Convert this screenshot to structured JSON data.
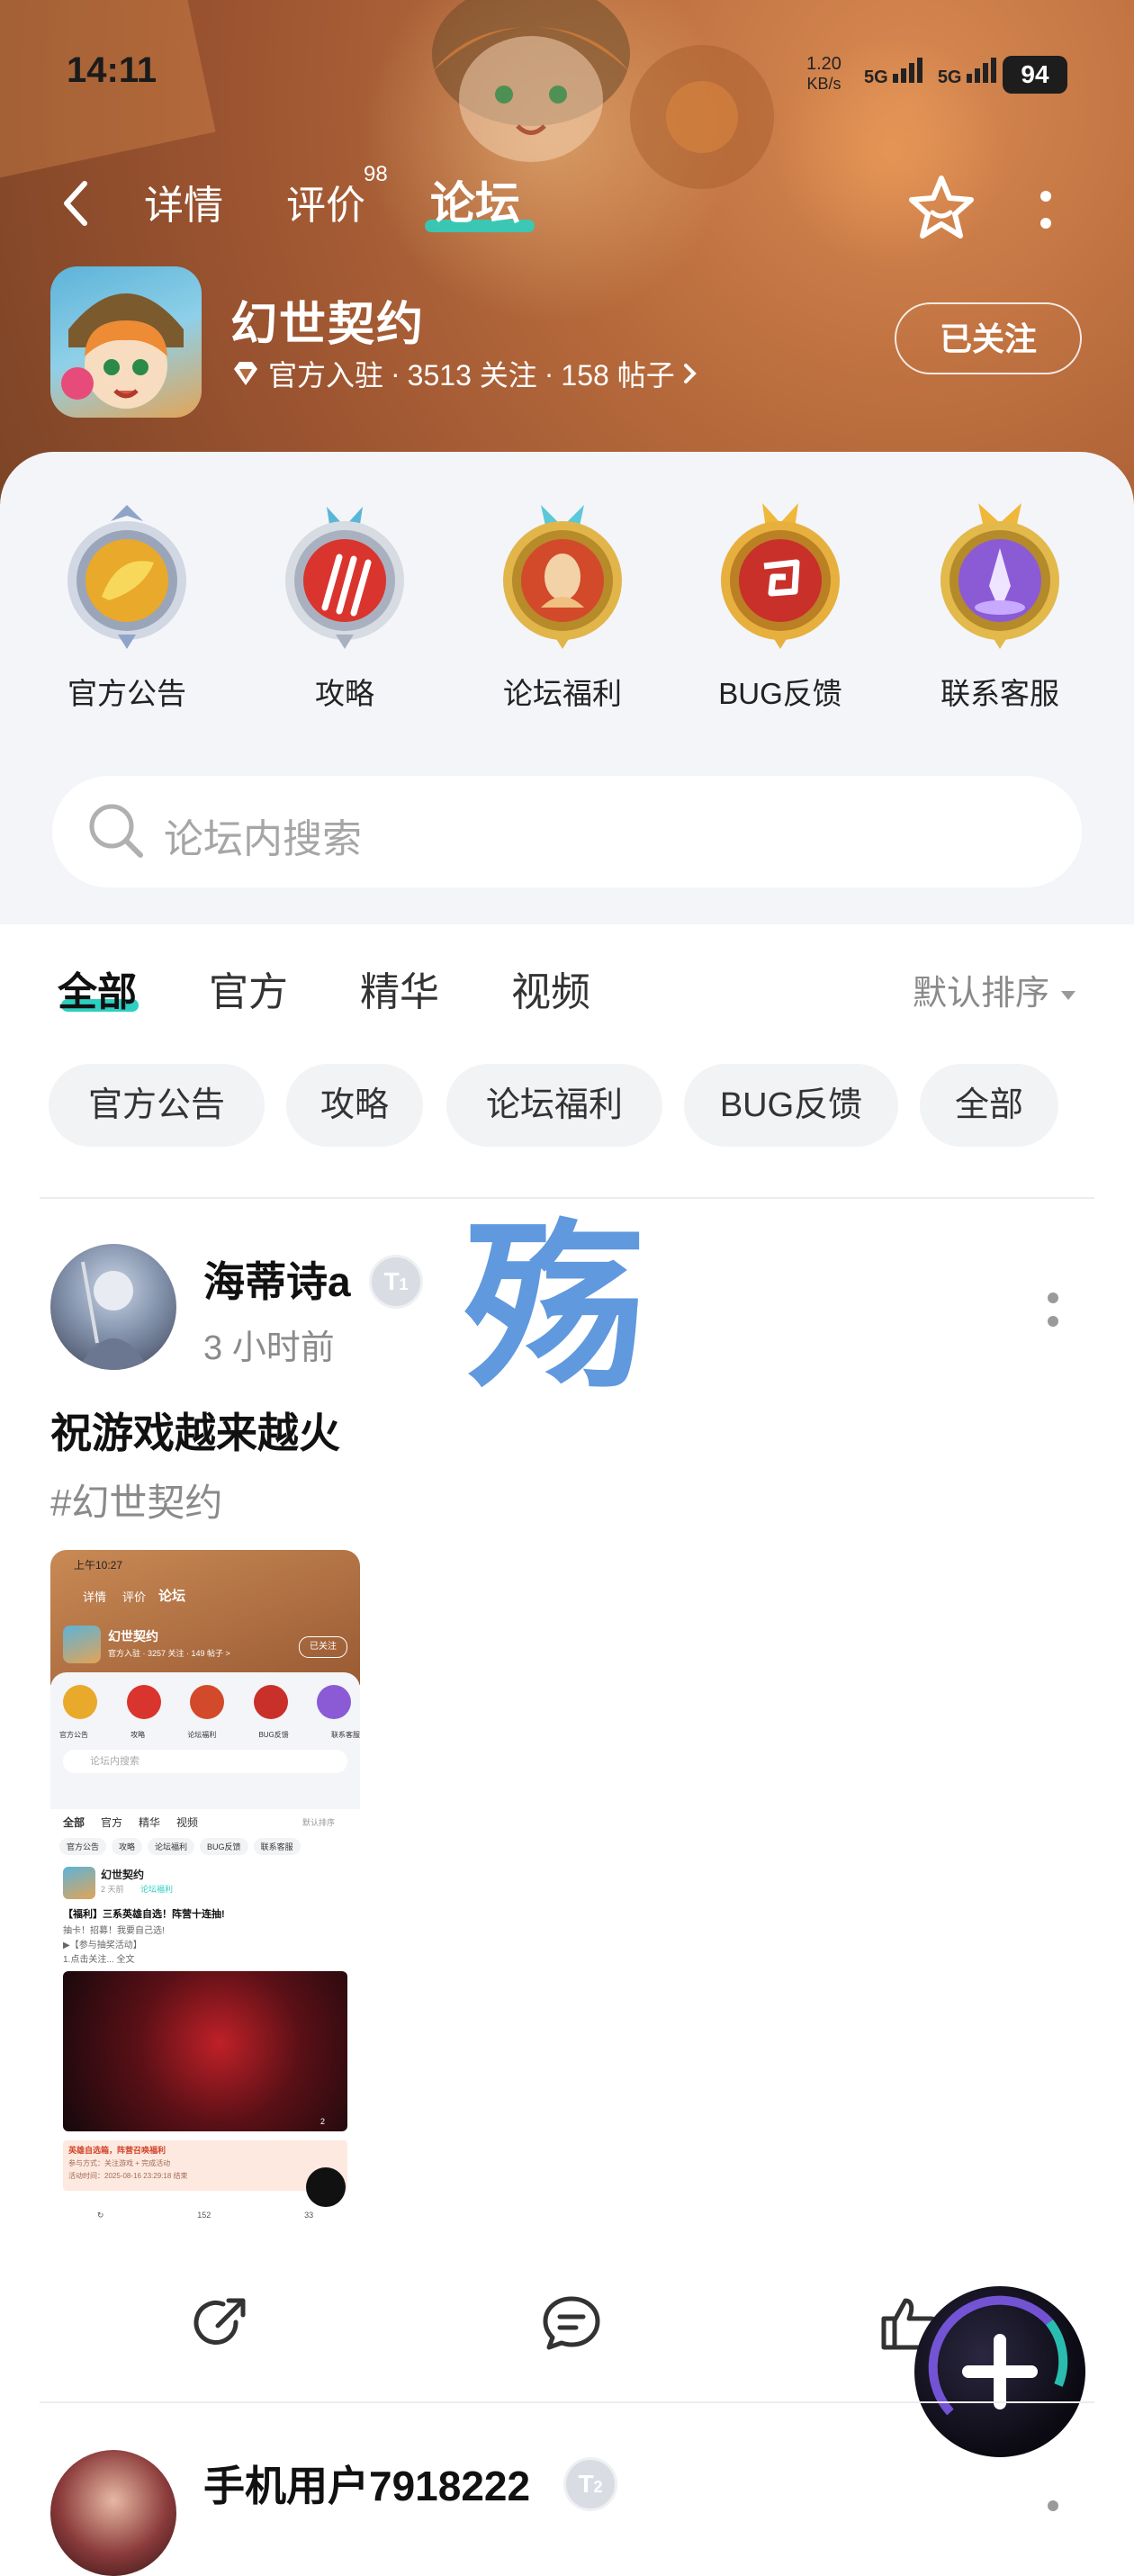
{
  "status_bar": {
    "time": "14:11",
    "net_speed_value": "1.20",
    "net_speed_unit": "KB/s",
    "signal1": "5G",
    "signal2": "5G",
    "battery": "94"
  },
  "nav": {
    "tabs": [
      {
        "label": "详情"
      },
      {
        "label": "评价"
      },
      {
        "label": "论坛"
      }
    ],
    "review_count": "98",
    "active_tab": "论坛"
  },
  "app": {
    "name": "幻世契约",
    "meta_official": "官方入驻",
    "meta_followers": "3513 关注",
    "meta_posts": "158 帖子",
    "meta_sep": "·",
    "follow_label": "已关注"
  },
  "categories": [
    {
      "label": "官方公告",
      "icon": "coin-emblem-icon",
      "color": "#e9a92a"
    },
    {
      "label": "攻略",
      "icon": "claw-emblem-icon",
      "color": "#d9352e"
    },
    {
      "label": "论坛福利",
      "icon": "hero-emblem-icon",
      "color": "#d24a2a"
    },
    {
      "label": "BUG反馈",
      "icon": "swirl-emblem-icon",
      "color": "#c9302a"
    },
    {
      "label": "联系客服",
      "icon": "crystal-emblem-icon",
      "color": "#8b5bd6"
    }
  ],
  "search": {
    "placeholder": "论坛内搜索"
  },
  "filter_tabs": [
    {
      "label": "全部"
    },
    {
      "label": "官方"
    },
    {
      "label": "精华"
    },
    {
      "label": "视频"
    }
  ],
  "sort_label": "默认排序",
  "chips": [
    {
      "label": "官方公告"
    },
    {
      "label": "攻略"
    },
    {
      "label": "论坛福利"
    },
    {
      "label": "BUG反馈"
    },
    {
      "label": "全部"
    }
  ],
  "post1": {
    "username": "海蒂诗a",
    "level": "1",
    "time": "3 小时前",
    "watermark_char": "殇",
    "title": "祝游戏越来越火",
    "tag": "#幻世契约",
    "thumb": {
      "time": "上午10:27",
      "tabs": [
        "详情",
        "评价",
        "论坛"
      ],
      "app_name": "幻世契约",
      "meta": "官方入驻 · 3257 关注 · 149 帖子 >",
      "follow": "已关注",
      "cats": [
        "官方公告",
        "攻略",
        "论坛福利",
        "BUG反馈",
        "联系客服"
      ],
      "search": "论坛内搜索",
      "filters": [
        "全部",
        "官方",
        "精华",
        "视频"
      ],
      "sort": "默认排序",
      "chips": [
        "官方公告",
        "攻略",
        "论坛福利",
        "BUG反馈",
        "联系客服"
      ],
      "post_user": "幻世契约",
      "post_time": "2 天前",
      "post_cat": "论坛福利",
      "post_title": "【福利】三系英雄自选！阵营十连抽!",
      "post_line1": "抽卡！招募！我要自己选!",
      "post_line2": "▶【参与抽奖活动】",
      "post_line3": "1.点击关注... 全文",
      "img_count": "2",
      "banner_title": "英雄自选箱，阵营召唤福利",
      "banner_line1": "参与方式：关注游戏 + 完成活动",
      "banner_line2": "活动时间：2025-08-16 23:29:18 结束",
      "comments": "152",
      "likes": "33"
    }
  },
  "post2": {
    "username": "手机用户7918222",
    "level": "2"
  }
}
